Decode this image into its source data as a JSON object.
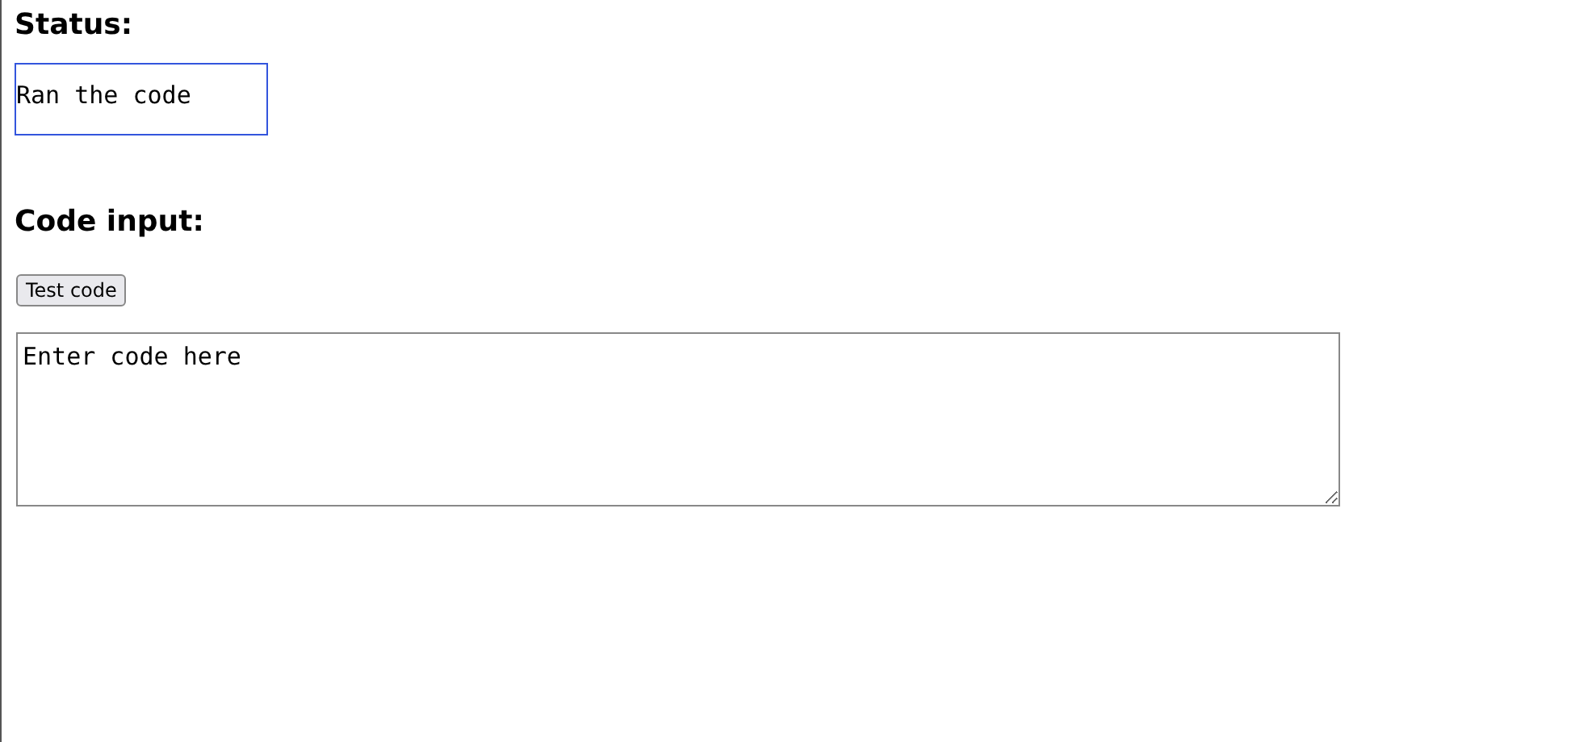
{
  "status": {
    "heading": "Status:",
    "text": "Ran the code"
  },
  "code_input": {
    "heading": "Code input:",
    "button": "Test code",
    "value": "Enter code here"
  }
}
